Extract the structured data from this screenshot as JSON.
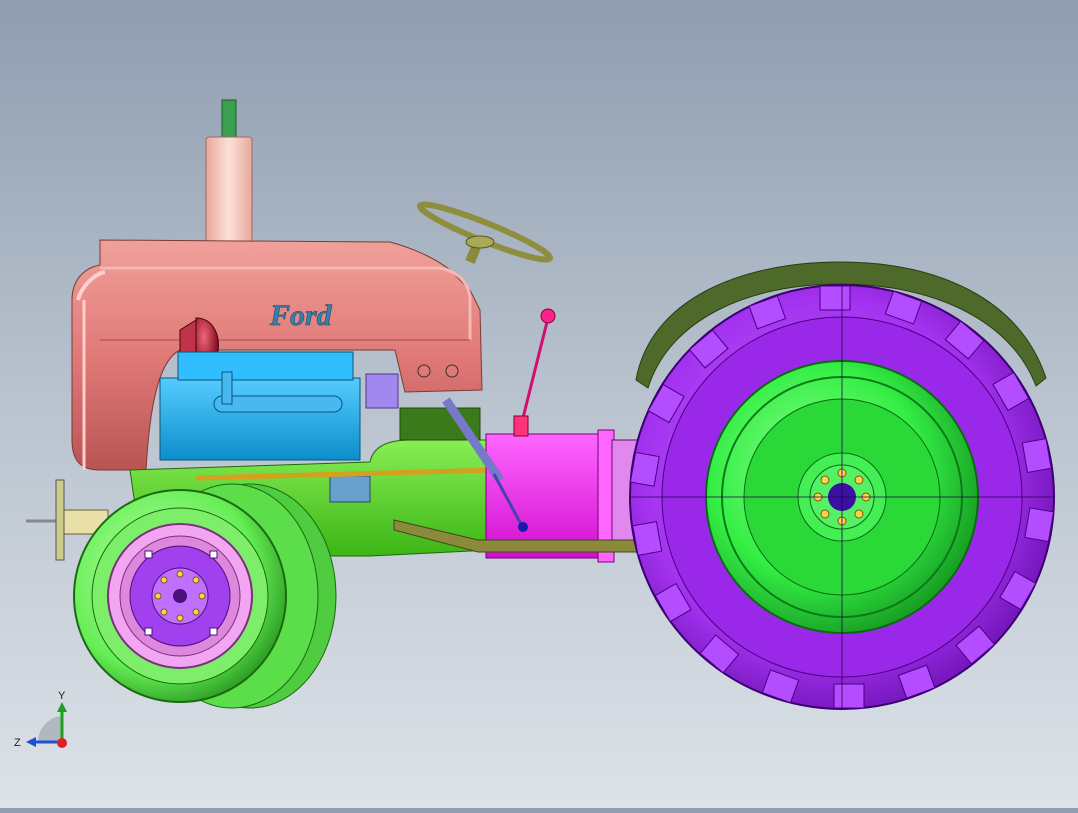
{
  "viewport": {
    "background_top": "#8f9db0",
    "background_bottom": "#dde2e8"
  },
  "model": {
    "brand_logo_text": "Ford",
    "part_colors": {
      "hood": "#e07a78",
      "engine_block": "#1cb4ee",
      "frame": "#55dd22",
      "transmission": "#ff22ff",
      "rear_tire": "#a432f0",
      "rear_rim": "#33ee44",
      "front_tire": "#66ee55",
      "front_rim": "#f2a6f2",
      "front_hub": "#a040ee",
      "fender": "#4d6a2a",
      "exhaust": "#f7c6bc",
      "steering_wheel": "#9a9a55",
      "headlight": "#9a0a2a"
    }
  },
  "triad": {
    "y_label": "Y",
    "z_label": "Z",
    "y_color": "#20a020",
    "z_color": "#2050d0",
    "x_color": "#e02020"
  }
}
